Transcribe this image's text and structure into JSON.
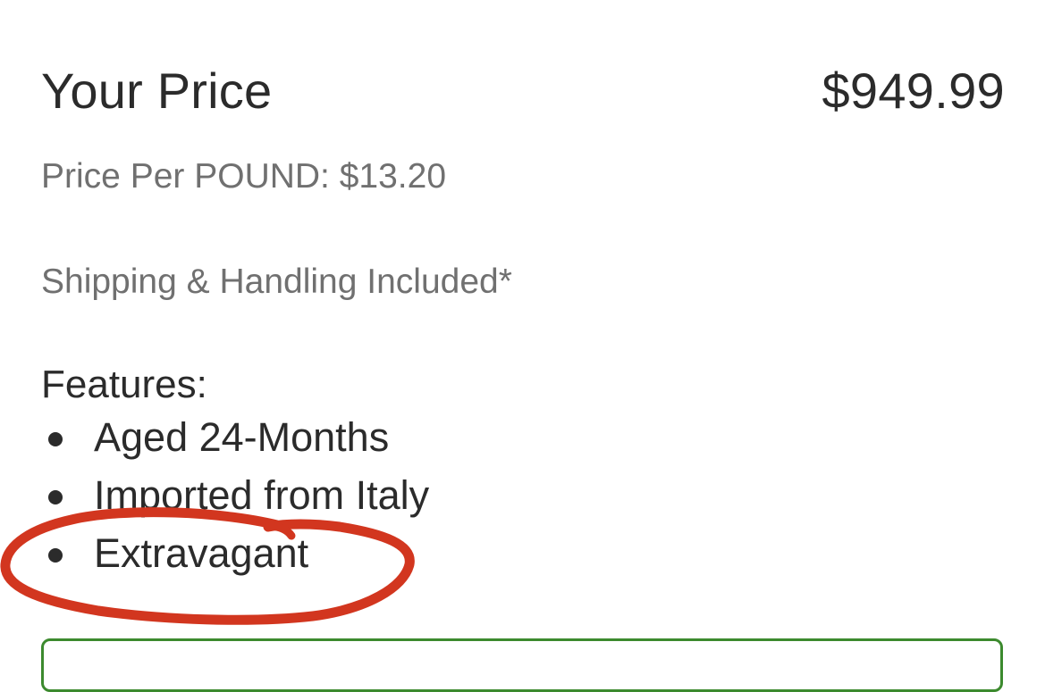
{
  "price": {
    "label": "Your Price",
    "value": "$949.99"
  },
  "unit_price": "Price Per POUND: $13.20",
  "shipping_note": "Shipping & Handling Included*",
  "features": {
    "heading": "Features:",
    "items": [
      "Aged 24-Months",
      "Imported from Italy",
      "Extravagant"
    ]
  },
  "colors": {
    "primary_text": "#2b2b2b",
    "secondary_text": "#707070",
    "annotation_red": "#d2361f",
    "box_border_green": "#3c8a2e"
  }
}
